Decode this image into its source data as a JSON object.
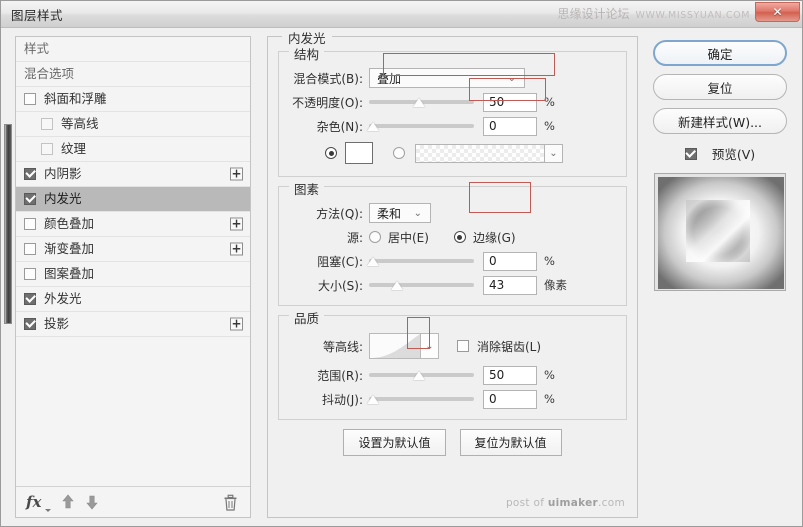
{
  "window": {
    "title": "图层样式",
    "close_label": "✕",
    "watermark_top": "思缘设计论坛",
    "watermark_top_url": "WWW.MISSYUAN.COM",
    "watermark_bottom_prefix": "post of ",
    "watermark_bottom_brand": "uimaker",
    "watermark_bottom_suffix": ".com"
  },
  "styles_panel": {
    "items": [
      {
        "label": "样式",
        "type": "header",
        "checkbox": "none",
        "plus": false,
        "selected": false
      },
      {
        "label": "混合选项",
        "type": "header",
        "checkbox": "none",
        "plus": false,
        "selected": false
      },
      {
        "label": "斜面和浮雕",
        "type": "item",
        "checkbox": "off",
        "plus": false,
        "selected": false
      },
      {
        "label": "等高线",
        "type": "sub",
        "checkbox": "off-dim",
        "plus": false,
        "selected": false
      },
      {
        "label": "纹理",
        "type": "sub",
        "checkbox": "off-dim",
        "plus": false,
        "selected": false
      },
      {
        "label": "内阴影",
        "type": "item",
        "checkbox": "on",
        "plus": true,
        "selected": false
      },
      {
        "label": "内发光",
        "type": "item",
        "checkbox": "on",
        "plus": false,
        "selected": true
      },
      {
        "label": "颜色叠加",
        "type": "item",
        "checkbox": "off",
        "plus": true,
        "selected": false
      },
      {
        "label": "渐变叠加",
        "type": "item",
        "checkbox": "off",
        "plus": true,
        "selected": false
      },
      {
        "label": "图案叠加",
        "type": "item",
        "checkbox": "off",
        "plus": false,
        "selected": false
      },
      {
        "label": "外发光",
        "type": "item",
        "checkbox": "on",
        "plus": false,
        "selected": false
      },
      {
        "label": "投影",
        "type": "item",
        "checkbox": "on",
        "plus": true,
        "selected": false
      }
    ],
    "toolbar": {
      "fx_label": "fx",
      "move_up": "move-up-arrow",
      "move_down": "move-down-arrow",
      "delete": "trash-icon"
    }
  },
  "options": {
    "panel_title": "内发光",
    "structure": {
      "title": "结构",
      "blend_mode_label": "混合模式(B):",
      "blend_mode_value": "叠加",
      "opacity_label": "不透明度(O):",
      "opacity_value": "50",
      "opacity_unit": "%",
      "noise_label": "杂色(N):",
      "noise_value": "0",
      "noise_unit": "%",
      "color_mode": "solid",
      "color_value": "#ffffff"
    },
    "elements": {
      "title": "图素",
      "technique_label": "方法(Q):",
      "technique_value": "柔和",
      "source_label": "源:",
      "source_center_label": "居中(E)",
      "source_edge_label": "边缘(G)",
      "source_selected": "edge",
      "choke_label": "阻塞(C):",
      "choke_value": "0",
      "choke_unit": "%",
      "size_label": "大小(S):",
      "size_value": "43",
      "size_unit": "像素"
    },
    "quality": {
      "title": "品质",
      "contour_label": "等高线:",
      "antialias_label": "消除锯齿(L)",
      "antialias_checked": false,
      "range_label": "范围(R):",
      "range_value": "50",
      "range_unit": "%",
      "jitter_label": "抖动(J):",
      "jitter_value": "0",
      "jitter_unit": "%"
    },
    "default_buttons": {
      "set_default": "设置为默认值",
      "reset_default": "复位为默认值"
    }
  },
  "right_panel": {
    "ok_label": "确定",
    "reset_label": "复位",
    "new_style_label": "新建样式(W)...",
    "preview_label": "预览(V)",
    "preview_checked": true
  },
  "colors": {
    "accent": "#7fa6cf",
    "highlight": "#c05a54",
    "selection": "#b9b9b9",
    "close": "#d2604f"
  }
}
